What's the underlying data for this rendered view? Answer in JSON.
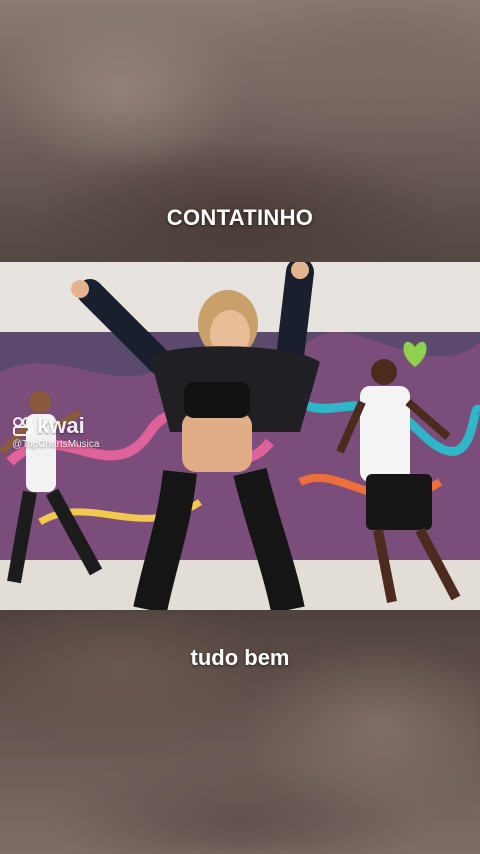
{
  "captions": {
    "top": "CONTATINHO",
    "bottom": "tudo bem"
  },
  "watermark": {
    "brand": "kwai",
    "handle": "@TopChartsMusica",
    "icon": "kwai-logo-icon"
  },
  "colors": {
    "caption_text": "#ffffff",
    "wall_mural_accent": "#8fd14f",
    "background_dark": "#3a2f2c"
  }
}
